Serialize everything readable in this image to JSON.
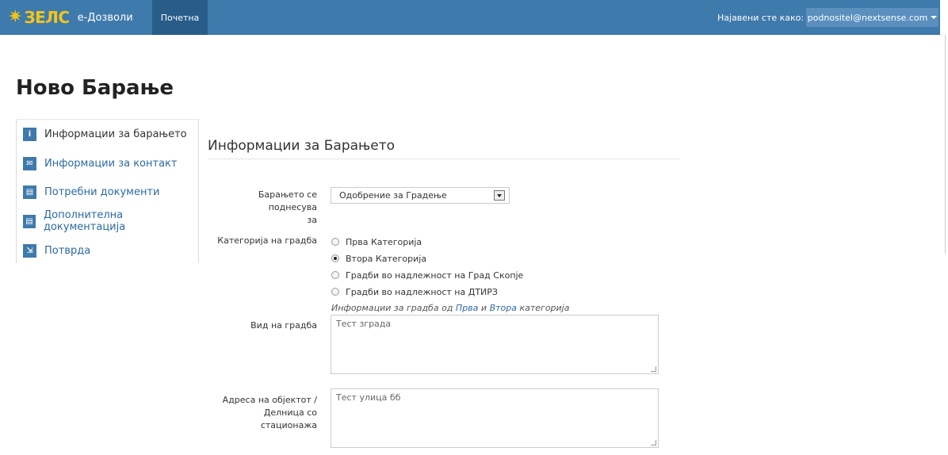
{
  "navbar": {
    "brand_mark": "ЗЕЛС",
    "app_name": "е-Дозволи",
    "home": "Почетна",
    "logged_in_label": "Најавени сте како:",
    "user": "podnositel@nextsense.com",
    "colors": {
      "bar": "#3f7aac",
      "active": "#285d8a",
      "logo": "#f5c518"
    }
  },
  "page": {
    "title": "Ново Барање"
  },
  "sidebar": {
    "items": [
      {
        "label": "Информации за барањето",
        "icon": "info-icon",
        "glyph": "i"
      },
      {
        "label": "Информации за контакт",
        "icon": "envelope-icon",
        "glyph": "✉"
      },
      {
        "label": "Потребни документи",
        "icon": "document-icon",
        "glyph": "▤"
      },
      {
        "label": "Дополнителна документација",
        "icon": "document-icon",
        "glyph": "▤"
      },
      {
        "label": "Потврда",
        "icon": "confirm-icon",
        "glyph": "⇲"
      }
    ]
  },
  "section": {
    "title": "Информации за Барањето"
  },
  "form": {
    "submitted_for": {
      "label_line1": "Барањето се поднесува",
      "label_line2": "за",
      "value": "Одобрение за Градење"
    },
    "category": {
      "label": "Категорија на градба",
      "options": [
        "Прва Категорија",
        "Втора Категорија",
        "Градби во надлежност на Град Скопје",
        "Градби во надлежност на ДТИРЗ"
      ],
      "selected": "Втора Категорија"
    },
    "hint": {
      "prefix": "Информации за градба од",
      "link1": "Прва",
      "middle": "и",
      "link2": "Втора",
      "suffix": "категорија"
    },
    "building_type": {
      "label": "Вид на градба",
      "value": "Тест зграда"
    },
    "address": {
      "label_line1": "Адреса на објектот /",
      "label_line2": "Делница со стационажа",
      "value": "Тест улица бб"
    }
  }
}
